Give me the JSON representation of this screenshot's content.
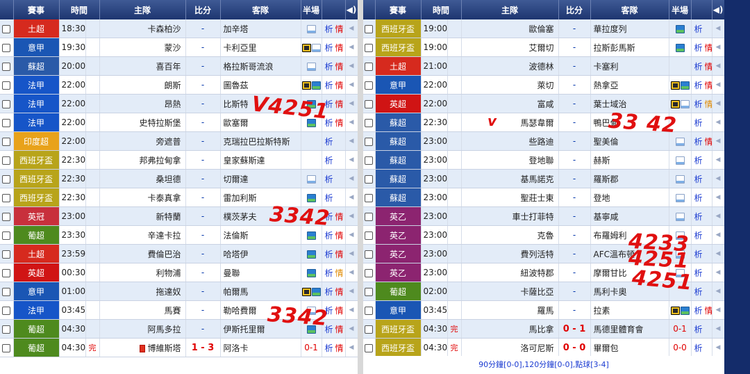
{
  "colors": {
    "header": "#1d3570",
    "leagues": {
      "土超": "#d62a1e",
      "意甲": "#1a56b4",
      "蘇超": "#2a5aa8",
      "法甲": "#1655c8",
      "印度超": "#e8a21a",
      "西班牙盃": "#b8a41a",
      "英冠": "#c8303c",
      "葡超": "#4e8a1e",
      "英超": "#d01414",
      "英乙": "#8c2470"
    }
  },
  "left": {
    "headers": [
      "賽事",
      "時間",
      "主隊",
      "比分",
      "客隊",
      "半場",
      "",
      "speaker"
    ],
    "rows": [
      {
        "league": "土超",
        "time": "18:30",
        "status": "",
        "home": "卡森柏沙",
        "score": "-",
        "away": "加辛塔",
        "half": "",
        "icons": [
          "chart"
        ],
        "xi": "析",
        "qing": "情",
        "qing_style": ""
      },
      {
        "league": "意甲",
        "time": "19:30",
        "status": "",
        "home": "蒙沙",
        "score": "-",
        "away": "卡利亞里",
        "half": "",
        "icons": [
          "tv",
          "chart"
        ],
        "xi": "析",
        "qing": "情",
        "qing_style": ""
      },
      {
        "league": "蘇超",
        "time": "20:00",
        "status": "",
        "home": "喜百年",
        "score": "-",
        "away": "格拉斯哥流浪",
        "half": "",
        "icons": [
          "chart"
        ],
        "xi": "析",
        "qing": "情",
        "qing_style": ""
      },
      {
        "league": "法甲",
        "time": "22:00",
        "status": "",
        "home": "朗斯",
        "score": "-",
        "away": "圖魯茲",
        "half": "",
        "icons": [
          "tv",
          "photo"
        ],
        "xi": "析",
        "qing": "情",
        "qing_style": ""
      },
      {
        "league": "法甲",
        "time": "22:00",
        "status": "",
        "home": "昂熱",
        "score": "-",
        "away": "比斯特",
        "half": "",
        "icons": [
          "photo"
        ],
        "xi": "析",
        "qing": "情",
        "qing_style": ""
      },
      {
        "league": "法甲",
        "time": "22:00",
        "status": "",
        "home": "史特拉斯堡",
        "score": "-",
        "away": "歐塞爾",
        "half": "",
        "icons": [
          "photo"
        ],
        "xi": "析",
        "qing": "情",
        "qing_style": ""
      },
      {
        "league": "印度超",
        "time": "22:00",
        "status": "",
        "home": "旁遮普",
        "score": "-",
        "away": "克瑞拉巴拉斯特斯",
        "half": "",
        "icons": [],
        "xi": "析",
        "qing": "",
        "qing_style": ""
      },
      {
        "league": "西班牙盃",
        "time": "22:30",
        "status": "",
        "home": "邦弗拉甸拿",
        "score": "-",
        "away": "皇家蘇斯達",
        "half": "",
        "icons": [],
        "xi": "析",
        "qing": "",
        "qing_style": ""
      },
      {
        "league": "西班牙盃",
        "time": "22:30",
        "status": "",
        "home": "桑坦德",
        "score": "-",
        "away": "切爾達",
        "half": "",
        "icons": [
          "chart"
        ],
        "xi": "析",
        "qing": "",
        "qing_style": ""
      },
      {
        "league": "西班牙盃",
        "time": "22:30",
        "status": "",
        "home": "卡泰真拿",
        "score": "-",
        "away": "雷加利斯",
        "half": "",
        "icons": [
          "photo"
        ],
        "xi": "析",
        "qing": "",
        "qing_style": ""
      },
      {
        "league": "英冠",
        "time": "23:00",
        "status": "",
        "home": "新特蘭",
        "score": "-",
        "away": "樸茨茅夫",
        "half": "",
        "icons": [],
        "xi": "析",
        "qing": "情",
        "qing_style": ""
      },
      {
        "league": "葡超",
        "time": "23:30",
        "status": "",
        "home": "辛達卡拉",
        "score": "-",
        "away": "法倫斯",
        "half": "",
        "icons": [
          "photo"
        ],
        "xi": "析",
        "qing": "情",
        "qing_style": ""
      },
      {
        "league": "土超",
        "time": "23:59",
        "status": "",
        "home": "費倫巴治",
        "score": "-",
        "away": "哈塔伊",
        "half": "",
        "icons": [
          "photo"
        ],
        "xi": "析",
        "qing": "情",
        "qing_style": ""
      },
      {
        "league": "英超",
        "time": "00:30",
        "status": "",
        "home": "利物浦",
        "score": "-",
        "away": "曼聯",
        "half": "",
        "icons": [
          "photo"
        ],
        "xi": "析",
        "qing": "情",
        "qing_style": "orange"
      },
      {
        "league": "意甲",
        "time": "01:00",
        "status": "",
        "home": "拖達奴",
        "score": "-",
        "away": "帕爾馬",
        "half": "",
        "icons": [
          "tv",
          "photo"
        ],
        "xi": "析",
        "qing": "情",
        "qing_style": ""
      },
      {
        "league": "法甲",
        "time": "03:45",
        "status": "",
        "home": "馬賽",
        "score": "-",
        "away": "勒哈費爾",
        "half": "",
        "icons": [
          "chart"
        ],
        "xi": "析",
        "qing": "情",
        "qing_style": ""
      },
      {
        "league": "葡超",
        "time": "04:30",
        "status": "",
        "home": "阿馬多拉",
        "score": "-",
        "away": "伊斯托里爾",
        "half": "",
        "icons": [
          "photo"
        ],
        "xi": "析",
        "qing": "情",
        "qing_style": ""
      },
      {
        "league": "葡超",
        "time": "04:30",
        "status": "完",
        "home": "博維斯塔",
        "score": "1 - 3",
        "away": "阿洛卡",
        "half": "0-1",
        "icons": [],
        "xi": "析",
        "qing": "情",
        "qing_style": "",
        "redcard": true
      }
    ]
  },
  "right": {
    "headers": [
      "賽事",
      "時間",
      "主隊",
      "比分",
      "客隊",
      "半場",
      "",
      "speaker"
    ],
    "rows": [
      {
        "league": "西班牙盃",
        "time": "19:00",
        "status": "",
        "home": "歐倫塞",
        "score": "-",
        "away": "華拉度列",
        "half": "",
        "icons": [
          "photo"
        ],
        "xi": "析",
        "qing": "",
        "qing_style": ""
      },
      {
        "league": "西班牙盃",
        "time": "19:00",
        "status": "",
        "home": "艾爾切",
        "score": "-",
        "away": "拉斯彭馬斯",
        "half": "",
        "icons": [
          "photo"
        ],
        "xi": "析",
        "qing": "情",
        "qing_style": ""
      },
      {
        "league": "土超",
        "time": "21:00",
        "status": "",
        "home": "波德林",
        "score": "-",
        "away": "卡塞利",
        "half": "",
        "icons": [],
        "xi": "析",
        "qing": "情",
        "qing_style": ""
      },
      {
        "league": "意甲",
        "time": "22:00",
        "status": "",
        "home": "萊切",
        "score": "-",
        "away": "熱拿亞",
        "half": "",
        "icons": [
          "tv",
          "photo"
        ],
        "xi": "析",
        "qing": "情",
        "qing_style": ""
      },
      {
        "league": "英超",
        "time": "22:00",
        "status": "",
        "home": "富咸",
        "score": "-",
        "away": "葉士域治",
        "half": "",
        "icons": [
          "tv",
          "chart"
        ],
        "xi": "析",
        "qing": "情",
        "qing_style": "orange"
      },
      {
        "league": "蘇超",
        "time": "22:30",
        "status": "",
        "home": "馬瑟韋爾",
        "score": "-",
        "away": "鴨巴甸",
        "half": "",
        "icons": [],
        "xi": "析",
        "qing": "",
        "qing_style": ""
      },
      {
        "league": "蘇超",
        "time": "23:00",
        "status": "",
        "home": "些路迪",
        "score": "-",
        "away": "聖美倫",
        "half": "",
        "icons": [
          "chart"
        ],
        "xi": "析",
        "qing": "情",
        "qing_style": ""
      },
      {
        "league": "蘇超",
        "time": "23:00",
        "status": "",
        "home": "登地聯",
        "score": "-",
        "away": "赫斯",
        "half": "",
        "icons": [
          "chart"
        ],
        "xi": "析",
        "qing": "",
        "qing_style": ""
      },
      {
        "league": "蘇超",
        "time": "23:00",
        "status": "",
        "home": "基馬諾克",
        "score": "-",
        "away": "羅斯郡",
        "half": "",
        "icons": [
          "chart"
        ],
        "xi": "析",
        "qing": "",
        "qing_style": ""
      },
      {
        "league": "蘇超",
        "time": "23:00",
        "status": "",
        "home": "聖莊士東",
        "score": "-",
        "away": "登地",
        "half": "",
        "icons": [
          "chart"
        ],
        "xi": "析",
        "qing": "",
        "qing_style": ""
      },
      {
        "league": "英乙",
        "time": "23:00",
        "status": "",
        "home": "車士打菲特",
        "score": "-",
        "away": "基寧咸",
        "half": "",
        "icons": [
          "chart"
        ],
        "xi": "析",
        "qing": "",
        "qing_style": ""
      },
      {
        "league": "英乙",
        "time": "23:00",
        "status": "",
        "home": "克魯",
        "score": "-",
        "away": "布羅姆利",
        "half": "",
        "icons": [
          "chart"
        ],
        "xi": "析",
        "qing": "",
        "qing_style": ""
      },
      {
        "league": "英乙",
        "time": "23:00",
        "status": "",
        "home": "費列活特",
        "score": "-",
        "away": "AFC溫布頓",
        "half": "",
        "icons": [
          "chart"
        ],
        "xi": "析",
        "qing": "",
        "qing_style": ""
      },
      {
        "league": "英乙",
        "time": "23:00",
        "status": "",
        "home": "紐波特郡",
        "score": "-",
        "away": "摩爾甘比",
        "half": "",
        "icons": [
          "chart"
        ],
        "xi": "析",
        "qing": "",
        "qing_style": ""
      },
      {
        "league": "葡超",
        "time": "02:00",
        "status": "",
        "home": "卡薩比亞",
        "score": "-",
        "away": "馬利卡奧",
        "half": "",
        "icons": [],
        "xi": "析",
        "qing": "",
        "qing_style": ""
      },
      {
        "league": "意甲",
        "time": "03:45",
        "status": "",
        "home": "羅馬",
        "score": "-",
        "away": "拉素",
        "half": "",
        "icons": [
          "tv",
          "photo"
        ],
        "xi": "析",
        "qing": "情",
        "qing_style": ""
      },
      {
        "league": "西班牙盃",
        "time": "04:30",
        "status": "完",
        "home": "馬比拿",
        "score": "0 - 1",
        "away": "馬德里體育會",
        "half": "0-1",
        "icons": [],
        "xi": "析",
        "qing": "",
        "qing_style": ""
      },
      {
        "league": "西班牙盃",
        "time": "04:30",
        "status": "完",
        "home": "洛可尼斯",
        "score": "0 - 0",
        "away": "畢爾包",
        "half": "0-0",
        "icons": [],
        "xi": "析",
        "qing": "",
        "qing_style": ""
      }
    ],
    "footer_note": "90分鐘[0-0],120分鐘[0-0],點球[3-4]"
  },
  "annotations": [
    {
      "text": "V4251"
    },
    {
      "text": "3342"
    },
    {
      "text": "3342"
    },
    {
      "text": "v"
    },
    {
      "text": "33 42"
    },
    {
      "text": "4233"
    },
    {
      "text": "4251"
    },
    {
      "text": "4251"
    }
  ]
}
